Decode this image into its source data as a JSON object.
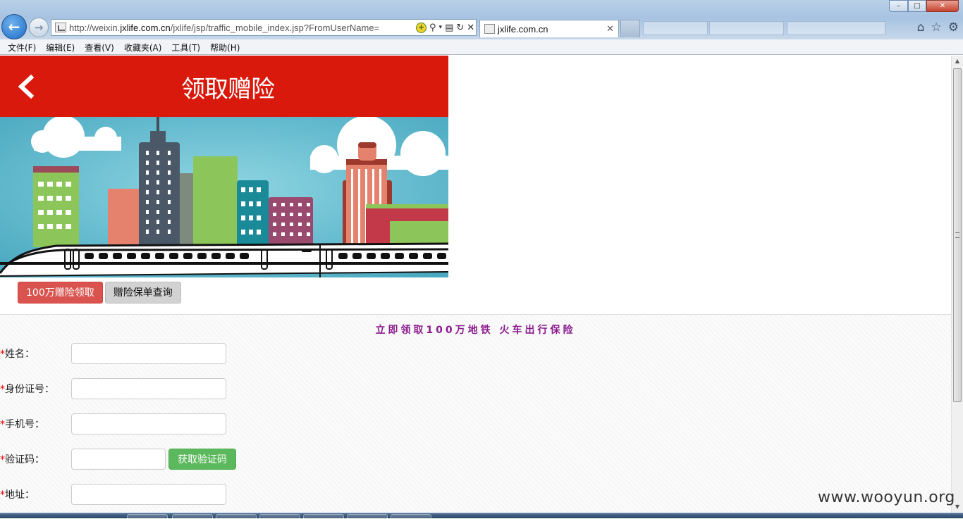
{
  "browser": {
    "address_url_prefix": "http://weixin.",
    "address_url_domain": "jxlife.com.cn",
    "address_url_suffix": "/jxlife/jsp/traffic_mobile_index.jsp?FromUserName=",
    "tab_title": "jxlife.com.cn",
    "window_controls": {
      "minimize": "–",
      "maximize": "□",
      "close": "✕"
    }
  },
  "menubar": {
    "items": [
      "文件(F)",
      "编辑(E)",
      "查看(V)",
      "收藏夹(A)",
      "工具(T)",
      "帮助(H)"
    ]
  },
  "page": {
    "title": "领取赠险",
    "tabs": [
      {
        "label": "100万赠险领取",
        "active": true
      },
      {
        "label": "赠险保单查询",
        "active": false
      }
    ],
    "form": {
      "heading": "立即领取100万地铁 火车出行保险",
      "required_mark": "*",
      "name_label": "姓名：",
      "id_label": "身份证号：",
      "phone_label": "手机号：",
      "code_label": "验证码：",
      "code_button": "获取验证码",
      "address_label": "地址："
    }
  },
  "watermark": "www.wooyun.org",
  "colors": {
    "header_red": "#d9190b",
    "active_tab": "#d9534f",
    "code_button": "#5cb85c",
    "heading_purple": "#8b1a8e"
  }
}
